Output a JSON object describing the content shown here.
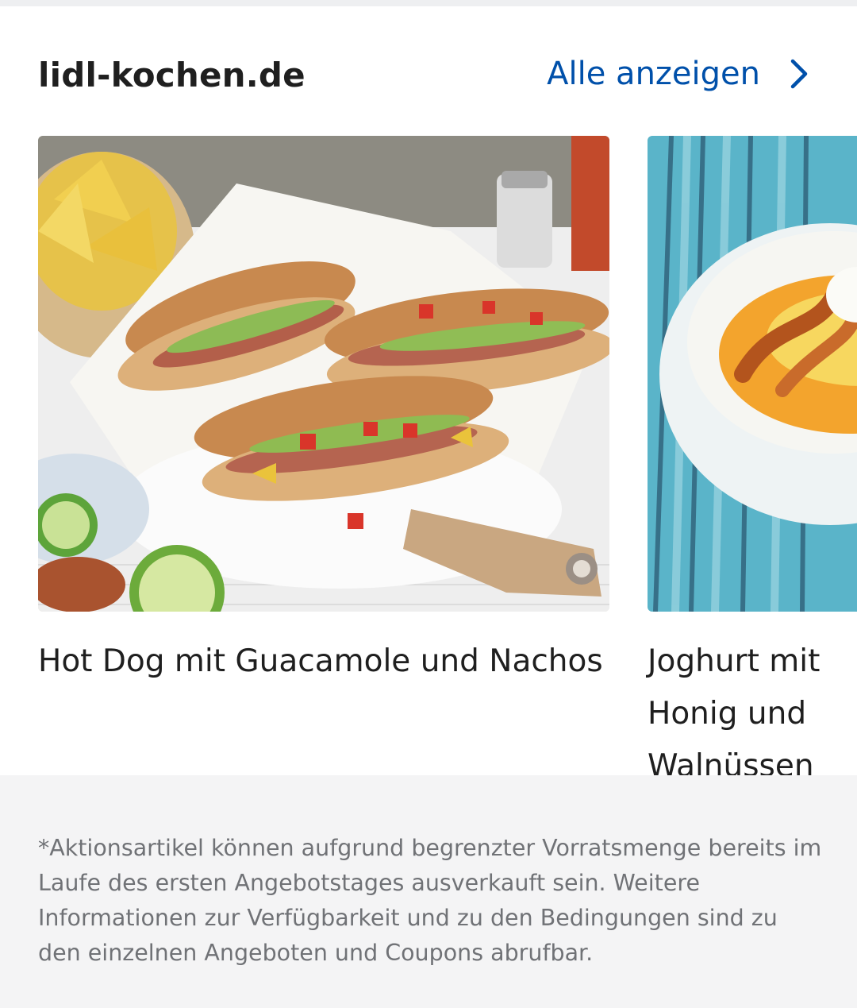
{
  "header": {
    "title": "lidl-kochen.de",
    "show_all_label": "Alle anzeigen"
  },
  "recipes": [
    {
      "title": "Hot Dog mit Guacamole und Nachos",
      "image": "hot-dog-photo"
    },
    {
      "title": "Joghurt mit Honig und Walnüssen",
      "image": "yogurt-bowl-photo"
    }
  ],
  "footer": {
    "disclaimer": "*Aktionsartikel können aufgrund begrenzter Vorratsmenge bereits im Laufe des ersten Angebotstages ausverkauft sein. Weitere Informationen zur Verfügbarkeit und zu den Bedingungen sind zu den einzelnen Angeboten und Coupons abrufbar."
  },
  "colors": {
    "link": "#0050aa",
    "text": "#1f1f1f",
    "footer_bg": "#f4f4f5",
    "footer_text": "#707276"
  }
}
